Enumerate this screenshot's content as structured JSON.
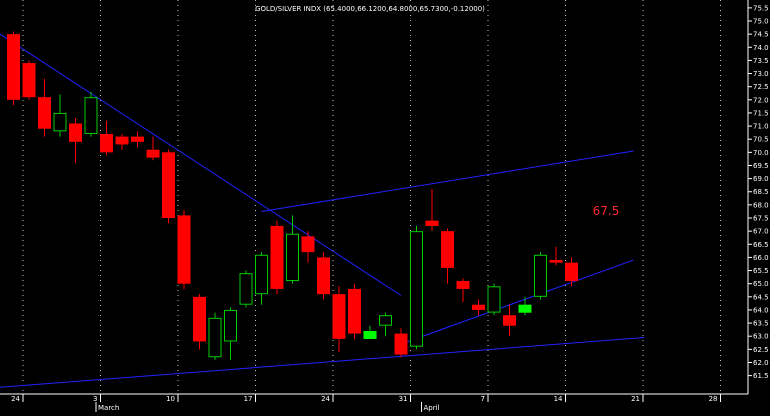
{
  "chart_data": {
    "type": "candlestick",
    "title": "GOLD/SILVER INDX (65.4000,66.1200,64.8000,65.7300,-0.12000)",
    "annotation": "67.5",
    "ylim": [
      60.8,
      75.8
    ],
    "price_axis_ticks": [
      "75.5",
      "75.0",
      "74.5",
      "74.0",
      "73.5",
      "73.0",
      "72.5",
      "72.0",
      "71.5",
      "71.0",
      "70.5",
      "70.0",
      "69.5",
      "69.0",
      "68.5",
      "68.0",
      "67.5",
      "67.0",
      "66.5",
      "66.0",
      "65.5",
      "65.0",
      "64.5",
      "64.0",
      "63.5",
      "63.0",
      "62.5",
      "62.0",
      "61.5"
    ],
    "x_ticks": [
      {
        "label": "24",
        "bar": 1
      },
      {
        "label": "3",
        "bar": 6
      },
      {
        "label": "10",
        "bar": 11
      },
      {
        "label": "17",
        "bar": 16
      },
      {
        "label": "24",
        "bar": 21
      },
      {
        "label": "31",
        "bar": 26
      },
      {
        "label": "7",
        "bar": 31
      },
      {
        "label": "14",
        "bar": 36
      },
      {
        "label": "21",
        "bar": 41
      },
      {
        "label": "28",
        "bar": 46
      }
    ],
    "month_labels": [
      {
        "label": "March",
        "bar": 6
      },
      {
        "label": "April",
        "bar": 27
      }
    ],
    "candles": [
      {
        "o": 74.5,
        "h": 74.6,
        "l": 71.8,
        "c": 72.0
      },
      {
        "o": 73.4,
        "h": 73.5,
        "l": 72.0,
        "c": 72.1
      },
      {
        "o": 72.1,
        "h": 72.8,
        "l": 70.6,
        "c": 70.9
      },
      {
        "o": 70.8,
        "h": 72.2,
        "l": 70.6,
        "c": 71.5
      },
      {
        "o": 71.1,
        "h": 71.3,
        "l": 69.6,
        "c": 70.4
      },
      {
        "o": 70.7,
        "h": 72.3,
        "l": 70.6,
        "c": 72.1
      },
      {
        "o": 70.7,
        "h": 71.2,
        "l": 69.9,
        "c": 70.0
      },
      {
        "o": 70.6,
        "h": 70.7,
        "l": 70.1,
        "c": 70.3
      },
      {
        "o": 70.6,
        "h": 70.8,
        "l": 70.2,
        "c": 70.4
      },
      {
        "o": 70.1,
        "h": 70.6,
        "l": 69.7,
        "c": 69.8
      },
      {
        "o": 70.0,
        "h": 70.1,
        "l": 67.3,
        "c": 67.5
      },
      {
        "o": 67.6,
        "h": 67.8,
        "l": 64.8,
        "c": 65.0
      },
      {
        "o": 64.5,
        "h": 64.6,
        "l": 62.5,
        "c": 62.8
      },
      {
        "o": 62.2,
        "h": 63.9,
        "l": 62.1,
        "c": 63.7
      },
      {
        "o": 62.8,
        "h": 64.1,
        "l": 62.1,
        "c": 64.0
      },
      {
        "o": 64.2,
        "h": 65.5,
        "l": 64.1,
        "c": 65.4
      },
      {
        "o": 64.6,
        "h": 66.2,
        "l": 64.2,
        "c": 66.1
      },
      {
        "o": 67.2,
        "h": 67.4,
        "l": 64.6,
        "c": 64.8
      },
      {
        "o": 65.1,
        "h": 67.6,
        "l": 65.0,
        "c": 66.9
      },
      {
        "o": 66.8,
        "h": 67.0,
        "l": 65.8,
        "c": 66.2
      },
      {
        "o": 66.0,
        "h": 66.2,
        "l": 64.4,
        "c": 64.6
      },
      {
        "o": 64.6,
        "h": 64.9,
        "l": 62.4,
        "c": 62.9
      },
      {
        "o": 64.8,
        "h": 65.0,
        "l": 62.9,
        "c": 63.1
      },
      {
        "o": 63.1,
        "h": 63.4,
        "l": 62.9,
        "c": 63.2
      },
      {
        "o": 63.4,
        "h": 63.9,
        "l": 63.0,
        "c": 63.8
      },
      {
        "o": 63.1,
        "h": 63.3,
        "l": 62.2,
        "c": 62.3
      },
      {
        "o": 62.6,
        "h": 67.2,
        "l": 62.5,
        "c": 67.0
      },
      {
        "o": 67.4,
        "h": 68.6,
        "l": 67.0,
        "c": 67.2
      },
      {
        "o": 67.0,
        "h": 67.1,
        "l": 65.0,
        "c": 65.6
      },
      {
        "o": 65.1,
        "h": 65.2,
        "l": 64.3,
        "c": 64.8
      },
      {
        "o": 64.2,
        "h": 64.4,
        "l": 63.8,
        "c": 64.0
      },
      {
        "o": 63.9,
        "h": 65.0,
        "l": 63.8,
        "c": 64.9
      },
      {
        "o": 63.8,
        "h": 64.2,
        "l": 63.0,
        "c": 63.4
      },
      {
        "o": 64.0,
        "h": 64.5,
        "l": 63.8,
        "c": 64.2
      },
      {
        "o": 64.5,
        "h": 66.2,
        "l": 64.4,
        "c": 66.1
      },
      {
        "o": 65.9,
        "h": 66.4,
        "l": 65.7,
        "c": 65.8
      },
      {
        "o": 65.8,
        "h": 66.0,
        "l": 64.9,
        "c": 65.1
      }
    ],
    "trendlines": [
      {
        "name": "upper-resistance",
        "bar1": -1.0,
        "p1": 74.55,
        "bar2": 25.0,
        "p2": 64.55
      },
      {
        "name": "channel-top",
        "bar1": 16.0,
        "p1": 67.75,
        "bar2": 40.0,
        "p2": 70.05
      },
      {
        "name": "channel-bottom",
        "bar1": 25.0,
        "p1": 62.7,
        "bar2": 40.0,
        "p2": 65.9
      },
      {
        "name": "long-support",
        "bar1": -1.0,
        "p1": 61.05,
        "bar2": 40.7,
        "p2": 62.95
      }
    ],
    "colors": {
      "background": "#000000",
      "down": "#ff0000",
      "up": "#00cc00",
      "doji_up": "#00ff00",
      "trendline": "#2222ff",
      "axis_text": "#ffffff",
      "grid": "#ffffff",
      "annotation": "#ff2a2a"
    },
    "grid": true
  }
}
